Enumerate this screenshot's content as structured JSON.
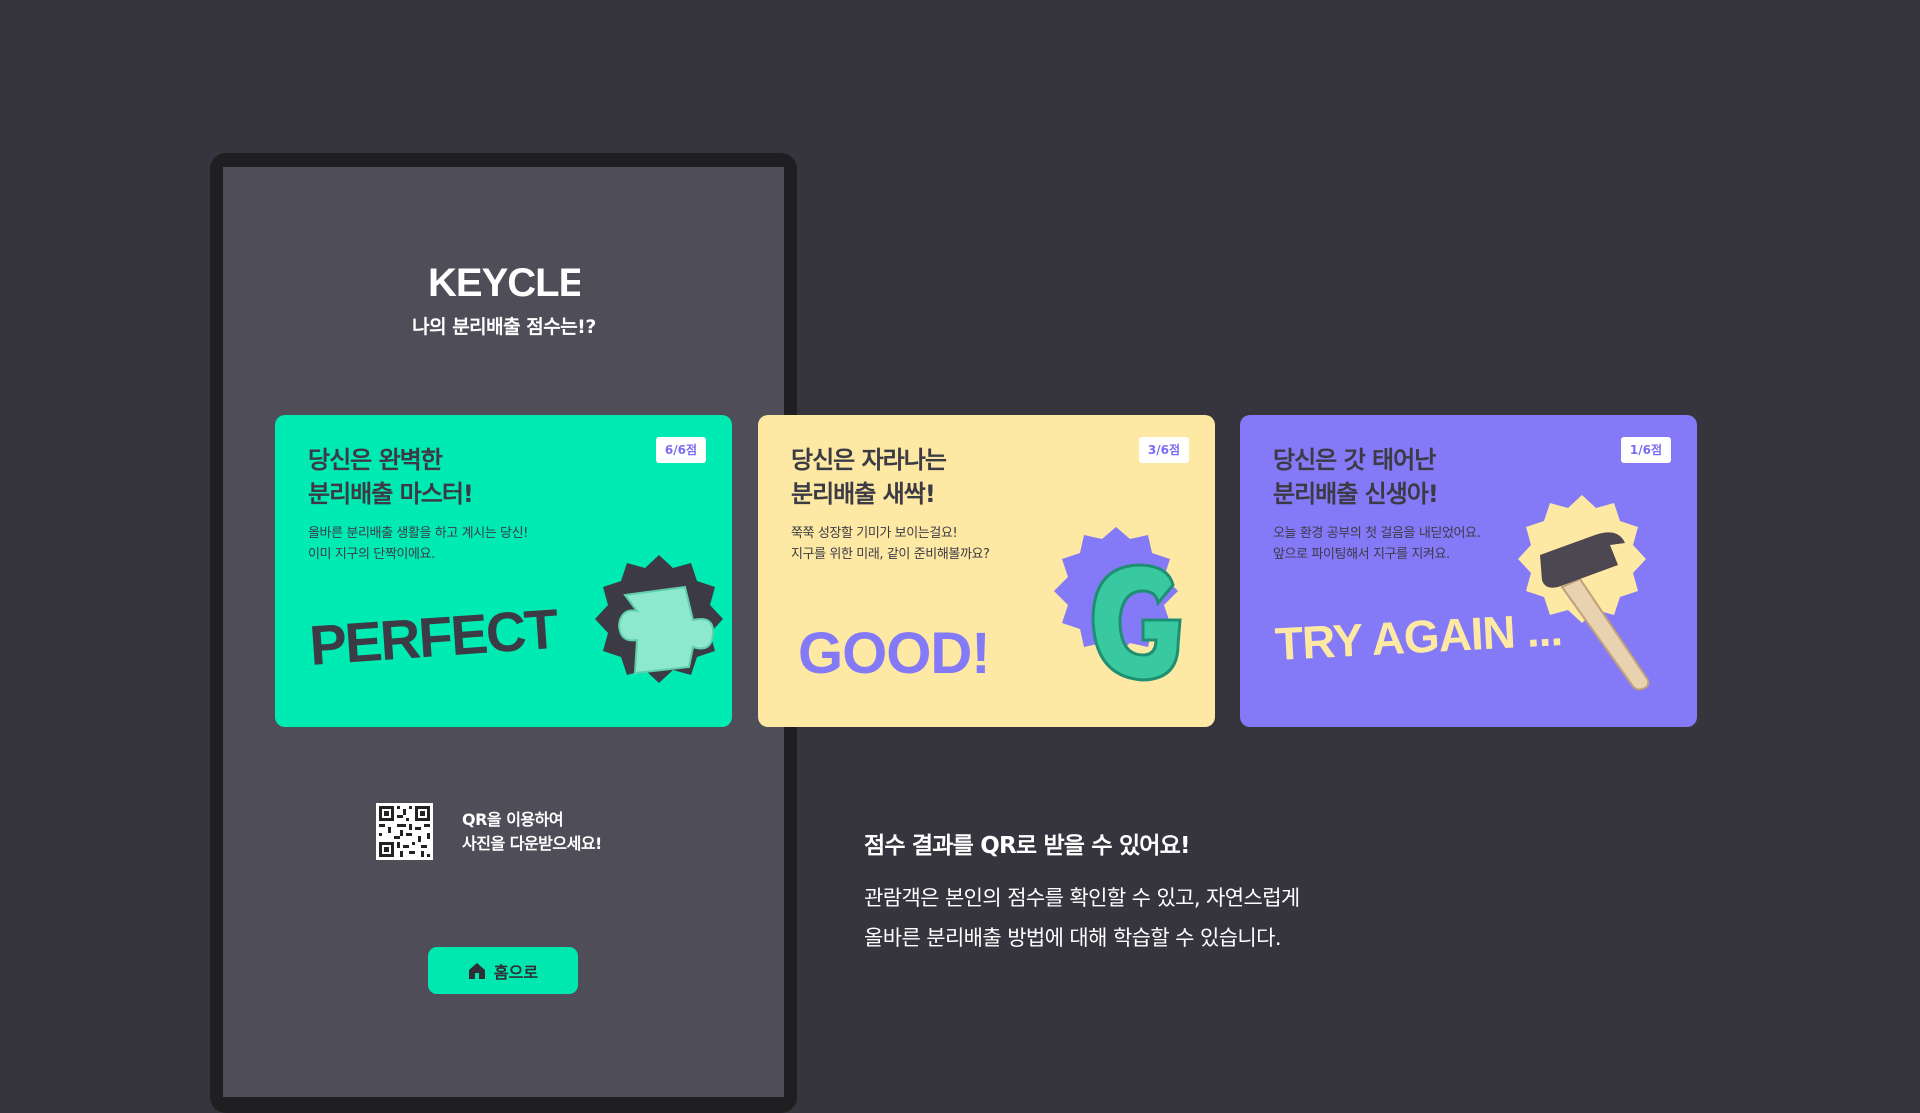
{
  "header": {
    "logo_text": "KEYCLE",
    "subtitle": "나의 분리배출 점수는!?"
  },
  "cards": [
    {
      "score": "6/6점",
      "title_line1": "당신은 완벽한",
      "title_line2": "분리배출 마스터!",
      "desc_line1": "올바른 분리배출 생활을 하고 계시는 당신!",
      "desc_line2": "이미 지구의 단짝이에요.",
      "art_text": "PERFECT",
      "bg": "#00eab3",
      "badge_color": "#7a6cf0",
      "icon": "puzzle-3d-icon"
    },
    {
      "score": "3/6점",
      "title_line1": "당신은 자라나는",
      "title_line2": "분리배출 새싹!",
      "desc_line1": "쭉쭉 성장할 기미가 보이는걸요!",
      "desc_line2": "지구를 위한 미래, 같이 준비해볼까요?",
      "art_text": "GOOD!",
      "bg": "#fde9a4",
      "badge_color": "#7a6cf0",
      "icon": "letter-g-3d-icon"
    },
    {
      "score": "1/6점",
      "title_line1": "당신은 갓 태어난",
      "title_line2": "분리배출 신생아!",
      "desc_line1": "오늘 환경 공부의 첫 걸음을 내딛었어요.",
      "desc_line2": "앞으로 파이팅해서 지구를 지켜요.",
      "art_text": "TRY AGAIN ...",
      "bg": "#8479f7",
      "badge_color": "#7a6cf0",
      "icon": "hammer-3d-icon"
    }
  ],
  "qr": {
    "line1": "QR을 이용하여",
    "line2": "사진을 다운받으세요!"
  },
  "home_button": {
    "label": "홈으로",
    "icon": "home-icon"
  },
  "description": {
    "title": "점수 결과를 QR로 받을 수 있어요!",
    "line1": "관람객은 본인의 점수를 확인할 수 있고, 자연스럽게",
    "line2": "올바른 분리배출 방법에 대해 학습할 수 있습니다."
  },
  "colors": {
    "background": "#36353e",
    "screen": "#4e4d58",
    "accent": "#00e8b0",
    "purple": "#8479f7",
    "yellow": "#fde9a4"
  }
}
